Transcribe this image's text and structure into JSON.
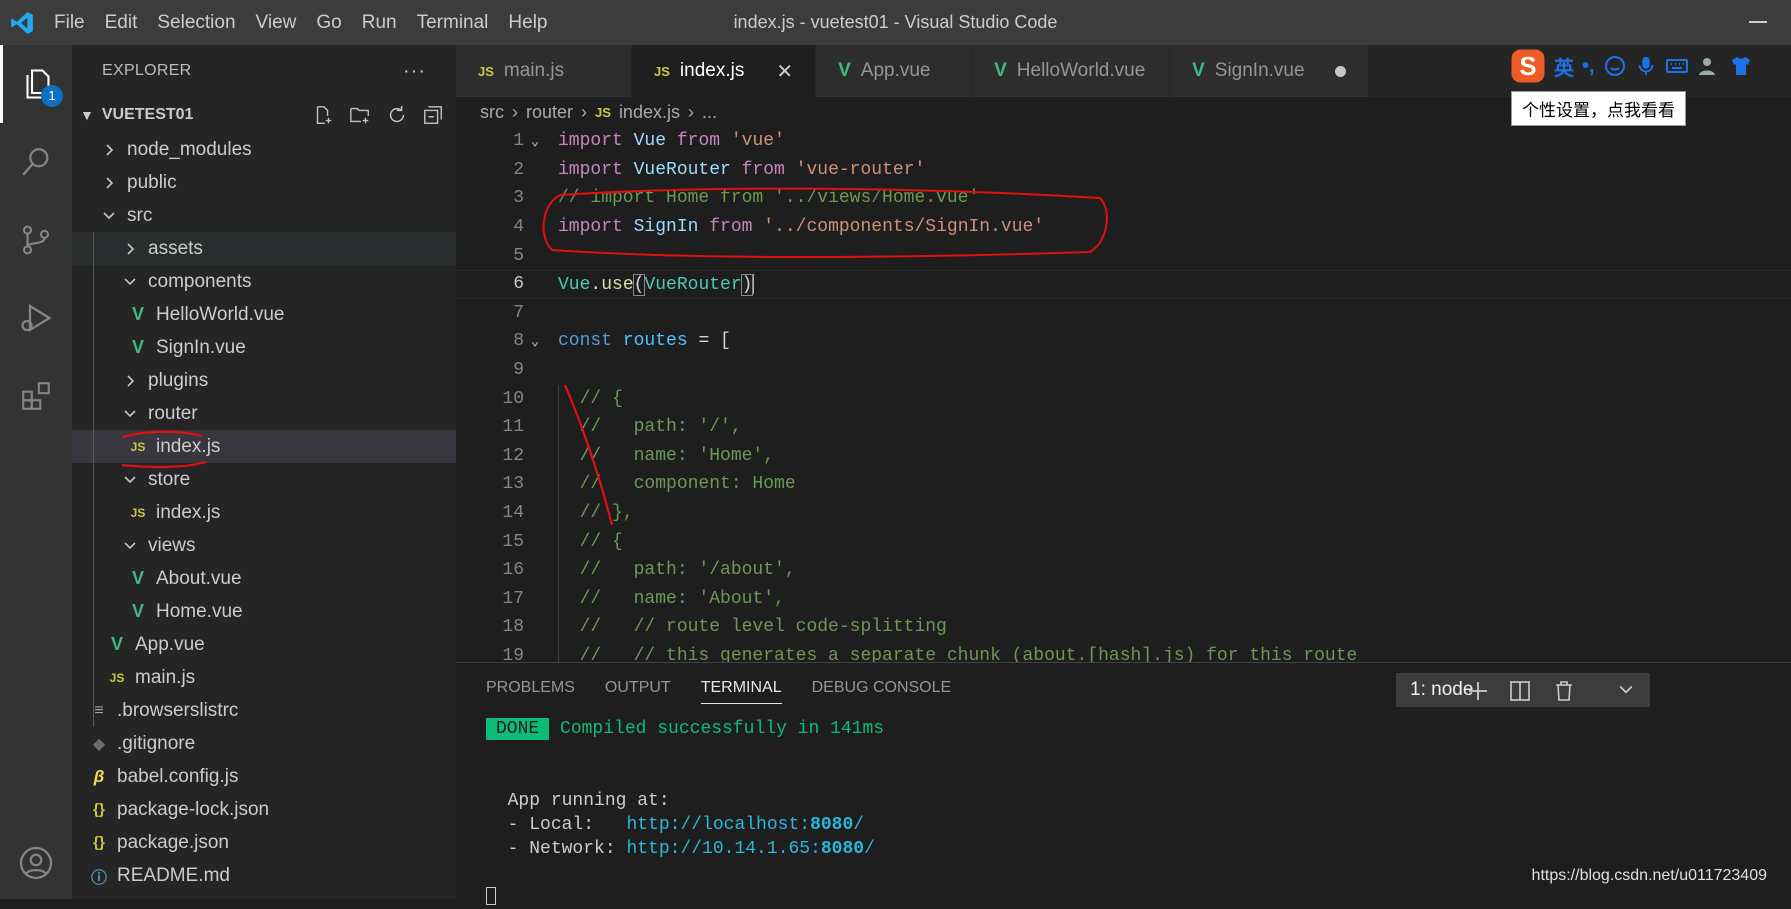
{
  "window": {
    "title": "index.js - vuetest01 - Visual Studio Code"
  },
  "menu": [
    "File",
    "Edit",
    "Selection",
    "View",
    "Go",
    "Run",
    "Terminal",
    "Help"
  ],
  "activity": {
    "explorer_badge": "1"
  },
  "explorer": {
    "title": "EXPLORER",
    "more": "···",
    "section": "VUETEST01",
    "items": [
      {
        "name": "node_modules",
        "kind": "folder",
        "open": false,
        "depth": 1
      },
      {
        "name": "public",
        "kind": "folder",
        "open": false,
        "depth": 1
      },
      {
        "name": "src",
        "kind": "folder",
        "open": true,
        "depth": 1
      },
      {
        "name": "assets",
        "kind": "folder",
        "open": false,
        "depth": 2
      },
      {
        "name": "components",
        "kind": "folder",
        "open": true,
        "depth": 2
      },
      {
        "name": "HelloWorld.vue",
        "kind": "vue",
        "depth": 3
      },
      {
        "name": "SignIn.vue",
        "kind": "vue",
        "depth": 3
      },
      {
        "name": "plugins",
        "kind": "folder",
        "open": false,
        "depth": 2
      },
      {
        "name": "router",
        "kind": "folder",
        "open": true,
        "depth": 2
      },
      {
        "name": "index.js",
        "kind": "js",
        "depth": 3,
        "selected": true
      },
      {
        "name": "store",
        "kind": "folder",
        "open": true,
        "depth": 2
      },
      {
        "name": "index.js",
        "kind": "js",
        "depth": 3
      },
      {
        "name": "views",
        "kind": "folder",
        "open": true,
        "depth": 2
      },
      {
        "name": "About.vue",
        "kind": "vue",
        "depth": 3
      },
      {
        "name": "Home.vue",
        "kind": "vue",
        "depth": 3
      },
      {
        "name": "App.vue",
        "kind": "vue",
        "depth": 2
      },
      {
        "name": "main.js",
        "kind": "js",
        "depth": 2
      },
      {
        "name": ".browserslistrc",
        "kind": "list",
        "depth": 1
      },
      {
        "name": ".gitignore",
        "kind": "git",
        "depth": 1
      },
      {
        "name": "babel.config.js",
        "kind": "babel",
        "depth": 1
      },
      {
        "name": "package-lock.json",
        "kind": "json",
        "depth": 1
      },
      {
        "name": "package.json",
        "kind": "json",
        "depth": 1
      },
      {
        "name": "README.md",
        "kind": "info",
        "depth": 1
      }
    ]
  },
  "tabs": [
    {
      "label": "main.js",
      "icon": "js",
      "active": false
    },
    {
      "label": "index.js",
      "icon": "js",
      "active": true,
      "close": "✕"
    },
    {
      "label": "App.vue",
      "icon": "vue",
      "active": false
    },
    {
      "label": "HelloWorld.vue",
      "icon": "vue",
      "active": false
    },
    {
      "label": "SignIn.vue",
      "icon": "vue",
      "active": false,
      "dirty": true
    }
  ],
  "breadcrumb": [
    "src",
    "router",
    "index.js",
    "..."
  ],
  "code": [
    [
      [
        "import ",
        "kw"
      ],
      [
        "Vue ",
        "var"
      ],
      [
        "from ",
        "kw"
      ],
      [
        "'vue'",
        "str"
      ]
    ],
    [
      [
        "import ",
        "kw"
      ],
      [
        "VueRouter ",
        "var"
      ],
      [
        "from ",
        "kw"
      ],
      [
        "'vue-router'",
        "str"
      ]
    ],
    [
      [
        "// import Home from '../views/Home.vue'",
        "cm"
      ]
    ],
    [
      [
        "import ",
        "kw"
      ],
      [
        "SignIn ",
        "var"
      ],
      [
        "from ",
        "kw"
      ],
      [
        "'../components/SignIn.vue'",
        "str"
      ]
    ],
    [],
    [
      [
        "Vue",
        "cls"
      ],
      [
        ".",
        ""
      ],
      [
        "use",
        "fn"
      ],
      [
        "(",
        "br"
      ],
      [
        "VueRouter",
        "cls"
      ],
      [
        ")",
        "br"
      ]
    ],
    [],
    [
      [
        "const ",
        "decl"
      ],
      [
        "routes ",
        "cv"
      ],
      [
        "= ",
        "op"
      ],
      [
        "[",
        "pl"
      ]
    ],
    [],
    [
      [
        "  // {",
        "cm"
      ]
    ],
    [
      [
        "  //   path: '/',",
        "cm"
      ]
    ],
    [
      [
        "  //   name: 'Home',",
        "cm"
      ]
    ],
    [
      [
        "  //   component: Home",
        "cm"
      ]
    ],
    [
      [
        "  // },",
        "cm"
      ]
    ],
    [
      [
        "  // {",
        "cm"
      ]
    ],
    [
      [
        "  //   path: '/about',",
        "cm"
      ]
    ],
    [
      [
        "  //   name: 'About',",
        "cm"
      ]
    ],
    [
      [
        "  //   // route level code-splitting",
        "cm"
      ]
    ],
    [
      [
        "  //   // this generates a separate chunk (about.[hash].js) for this route",
        "cm"
      ]
    ]
  ],
  "panel": {
    "tabs": [
      "PROBLEMS",
      "OUTPUT",
      "TERMINAL",
      "DEBUG CONSOLE"
    ],
    "active_tab": "TERMINAL",
    "terminal_select": "1: node",
    "done_label": "DONE",
    "compiled": "Compiled successfully in 141ms",
    "app_running": "App running at:",
    "local_label": "- Local:   ",
    "local_url_host": "http://localhost:",
    "local_port": "8080",
    "local_tail": "/",
    "network_label": "- Network: ",
    "network_url_host": "http://10.14.1.65:",
    "network_port": "8080",
    "network_tail": "/"
  },
  "ime": {
    "lang": "英",
    "tooltip": "个性设置，点我看看"
  },
  "watermark": "https://blog.csdn.net/u011723409",
  "colors": {
    "kw": "#c586c0",
    "var": "#9cdcfe",
    "str": "#ce9178",
    "cm": "#6a9955",
    "decl": "#569cd6",
    "cv": "#4fc1ff",
    "fn": "#dcdcaa",
    "cls": "#4ec9b0",
    "pl": "#d4d4d4",
    "annotation": "#e01010"
  }
}
